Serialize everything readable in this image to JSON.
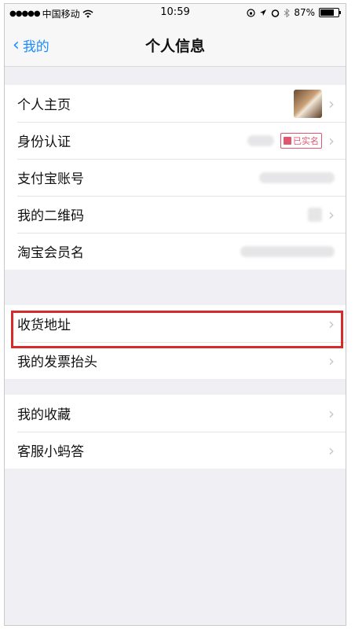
{
  "status_bar": {
    "signal_dots": "●●●●●",
    "carrier": "中国移动",
    "time": "10:59",
    "battery_percent": "87%",
    "battery_level": 0.87,
    "icons": [
      "wifi-icon",
      "lock-rotation-icon",
      "location-icon",
      "alarm-icon",
      "bluetooth-icon",
      "battery-icon"
    ]
  },
  "nav": {
    "back_label": "我的",
    "title": "个人信息"
  },
  "groups": [
    {
      "rows": [
        {
          "label": "个人主页"
        },
        {
          "label": "身份认证",
          "badge": "已实名"
        },
        {
          "label": "支付宝账号"
        },
        {
          "label": "我的二维码"
        },
        {
          "label": "淘宝会员名"
        }
      ]
    },
    {
      "rows": [
        {
          "label": "收货地址"
        },
        {
          "label": "我的发票抬头"
        }
      ]
    },
    {
      "rows": [
        {
          "label": "我的收藏"
        },
        {
          "label": "客服小蚂答"
        }
      ]
    }
  ],
  "chevron_glyph": "›",
  "back_glyph": "‹",
  "highlight_color": "#d72a2a",
  "accent_color": "#1a8cff"
}
